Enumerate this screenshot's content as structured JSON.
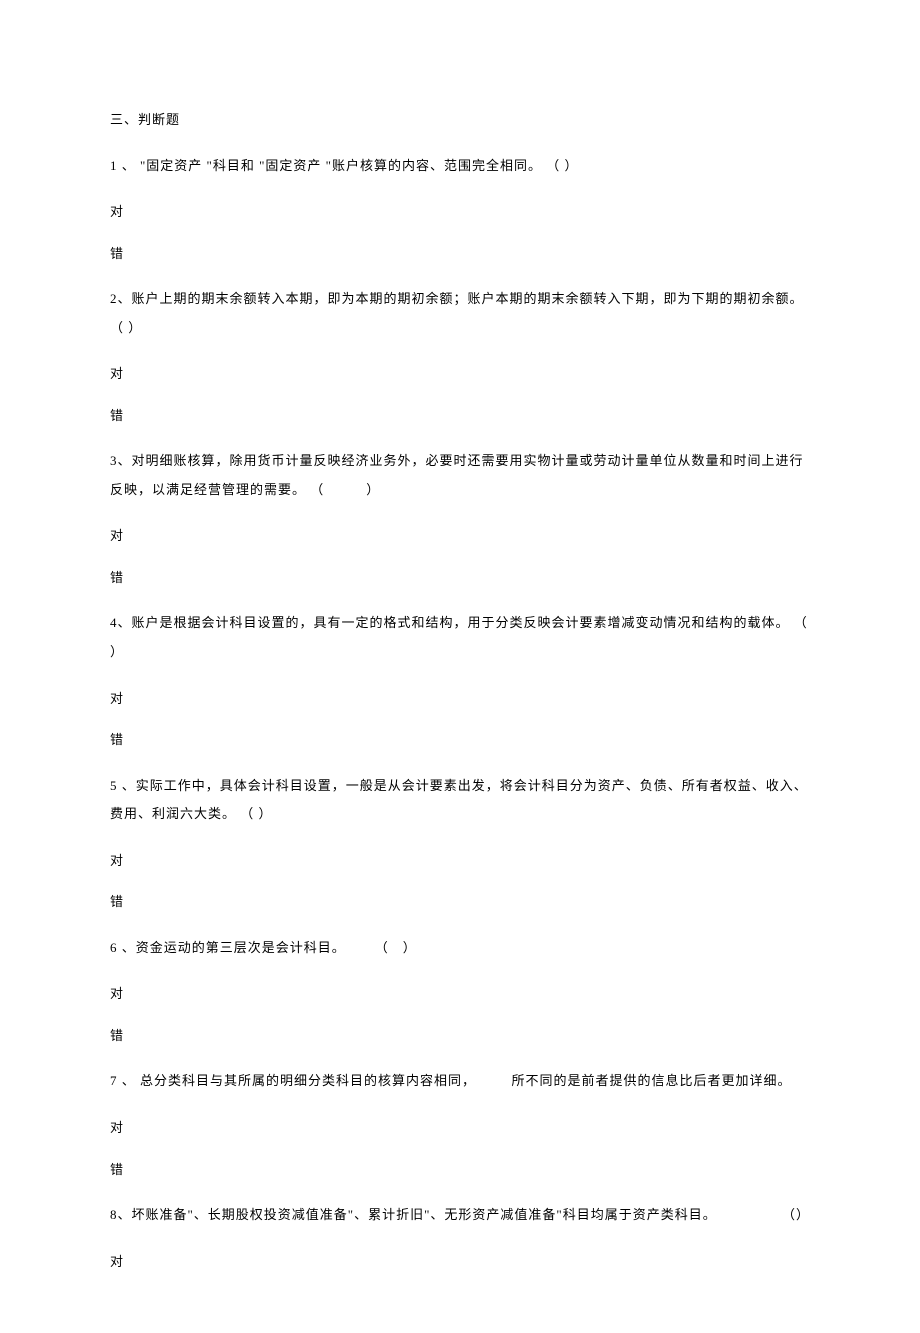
{
  "section_title": "三、判断题",
  "questions": [
    {
      "text": "1 、 \"固定资产 \"科目和 \"固定资产 \"账户核算的内容、范围完全相同。 （  ）",
      "option_true": "对",
      "option_false": "错"
    },
    {
      "text": "2、账户上期的期末余额转入本期，即为本期的期初余额；账户本期的期末余额转入下期，即为下期的期初余额。 （  ）",
      "option_true": "对",
      "option_false": "错"
    },
    {
      "text": "3、对明细账核算，除用货币计量反映经济业务外，必要时还需要用实物计量或劳动计量单位从数量和时间上进行反映，以满足经营管理的需要。 （　　　）",
      "option_true": "对",
      "option_false": "错"
    },
    {
      "text": "4、账户是根据会计科目设置的，具有一定的格式和结构，用于分类反映会计要素增减变动情况和结构的载体。 （  ）",
      "option_true": "对",
      "option_false": "错"
    },
    {
      "text": "5 、实际工作中，具体会计科目设置，一般是从会计要素出发，将会计科目分为资产、负债、所有者权益、收入、费用、利润六大类。 （  ）",
      "option_true": "对",
      "option_false": "错"
    },
    {
      "text": "6 、资金运动的第三层次是会计科目。　　　（　）",
      "option_true": "对",
      "option_false": "错"
    },
    {
      "text": "7 、 总分类科目与其所属的明细分类科目的核算内容相同，　　　所不同的是前者提供的信息比后者更加详细。",
      "option_true": "对",
      "option_false": "错"
    },
    {
      "text": "8、坏账准备\"、长期股权投资减值准备\"、累计折旧\"、无形资产减值准备\"科目均属于资产类科目。",
      "paren": "（）",
      "option_true": "对",
      "option_false": ""
    }
  ]
}
